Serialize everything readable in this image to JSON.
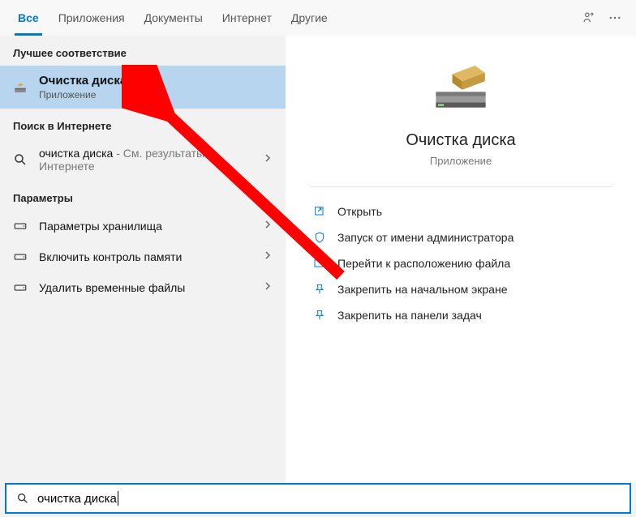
{
  "tabs": {
    "items": [
      {
        "label": "Все",
        "active": true
      },
      {
        "label": "Приложения"
      },
      {
        "label": "Документы"
      },
      {
        "label": "Интернет"
      },
      {
        "label": "Другие",
        "dropdown": true
      }
    ]
  },
  "sections": {
    "best_match": "Лучшее соответствие",
    "web_search": "Поиск в Интернете",
    "settings": "Параметры"
  },
  "best_match": {
    "title": "Очистка диска",
    "subtitle": "Приложение"
  },
  "web": {
    "title": "очистка диска",
    "subtitle": " - См. результаты в Интернете"
  },
  "settings_items": [
    "Параметры хранилища",
    "Включить контроль памяти",
    "Удалить временные файлы"
  ],
  "preview": {
    "title": "Очистка диска",
    "subtitle": "Приложение",
    "actions": [
      "Открыть",
      "Запуск от имени администратора",
      "Перейти к расположению файла",
      "Закрепить на начальном экране",
      "Закрепить на панели задач"
    ]
  },
  "search": {
    "value": "очистка диска"
  }
}
